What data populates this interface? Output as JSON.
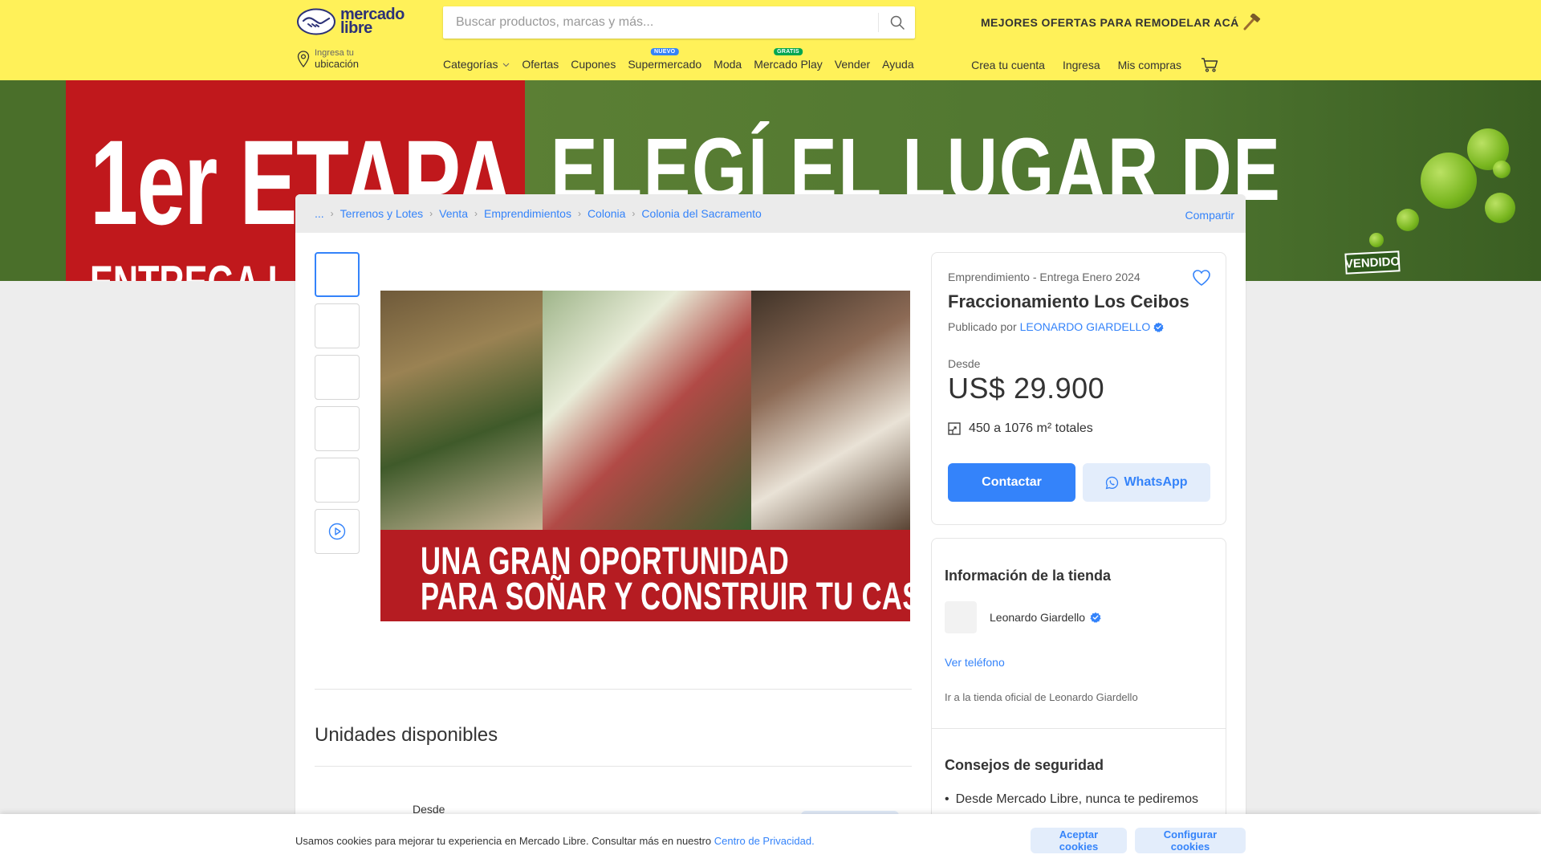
{
  "header": {
    "logo_line1": "mercado",
    "logo_line2": "libre",
    "search_placeholder": "Buscar productos, marcas y más...",
    "promo": "MEJORES OFERTAS PARA REMODELAR ACÁ",
    "location_small": "Ingresa tu",
    "location_big": "ubicación",
    "nav": [
      {
        "label": "Categorías"
      },
      {
        "label": "Ofertas"
      },
      {
        "label": "Cupones"
      },
      {
        "label": "Supermercado",
        "badge": "NUEVO"
      },
      {
        "label": "Moda"
      },
      {
        "label": "Mercado Play",
        "badge": "GRATIS"
      },
      {
        "label": "Vender"
      },
      {
        "label": "Ayuda"
      }
    ],
    "user_nav": [
      "Crea tu cuenta",
      "Ingresa",
      "Mis compras"
    ]
  },
  "banner": {
    "text_left": "1er ETAPA",
    "text_left_sub": "ENTREGA I",
    "text_right": "ELEGÍ EL LUGAR DE",
    "stamp": "VENDIDO"
  },
  "breadcrumb": {
    "items": [
      "...",
      "Terrenos y Lotes",
      "Venta",
      "Emprendimientos",
      "Colonia",
      "Colonia del Sacramento"
    ],
    "share": "Compartir"
  },
  "gallery": {
    "caption_line1": "UNA GRAN OPORTUNIDAD",
    "caption_line2": "PARA SOÑAR Y CONSTRUIR TU CASA"
  },
  "listing": {
    "eyebrow": "Emprendimiento - Entrega Enero 2024",
    "title": "Fraccionamiento Los Ceibos",
    "published_by": "Publicado por",
    "seller": "LEONARDO GIARDELLO",
    "price_label": "Desde",
    "price": "US$ 29.900",
    "area": "450 a 1076 m² totales",
    "contact_button": "Contactar",
    "whatsapp_button": "WhatsApp"
  },
  "store": {
    "title": "Información de la tienda",
    "name": "Leonardo Giardello",
    "phone_link": "Ver teléfono",
    "official_prefix": "Ir a la tienda oficial de",
    "official_link": "Leonardo Giardello",
    "tips_title": "Consejos de seguridad",
    "tip1": "Desde Mercado Libre, nunca te pediremos"
  },
  "units": {
    "title": "Unidades disponibles",
    "desde": "Desde"
  },
  "cookies": {
    "text": "Usamos cookies para mejorar tu experiencia en Mercado Libre. Consultar más en nuestro",
    "link": "Centro de Privacidad.",
    "accept": "Aceptar cookies",
    "configure": "Configurar cookies"
  },
  "colors": {
    "header": "#fff159",
    "accent": "#3483fa",
    "banner_red": "#c0181c"
  },
  "icons": [
    "handshake-logo-icon",
    "search-icon",
    "hammer-icon",
    "location-pin-icon",
    "chevron-down-icon",
    "cart-icon",
    "chevron-right-icon",
    "heart-icon",
    "verified-icon",
    "area-icon",
    "whatsapp-icon",
    "play-icon"
  ]
}
